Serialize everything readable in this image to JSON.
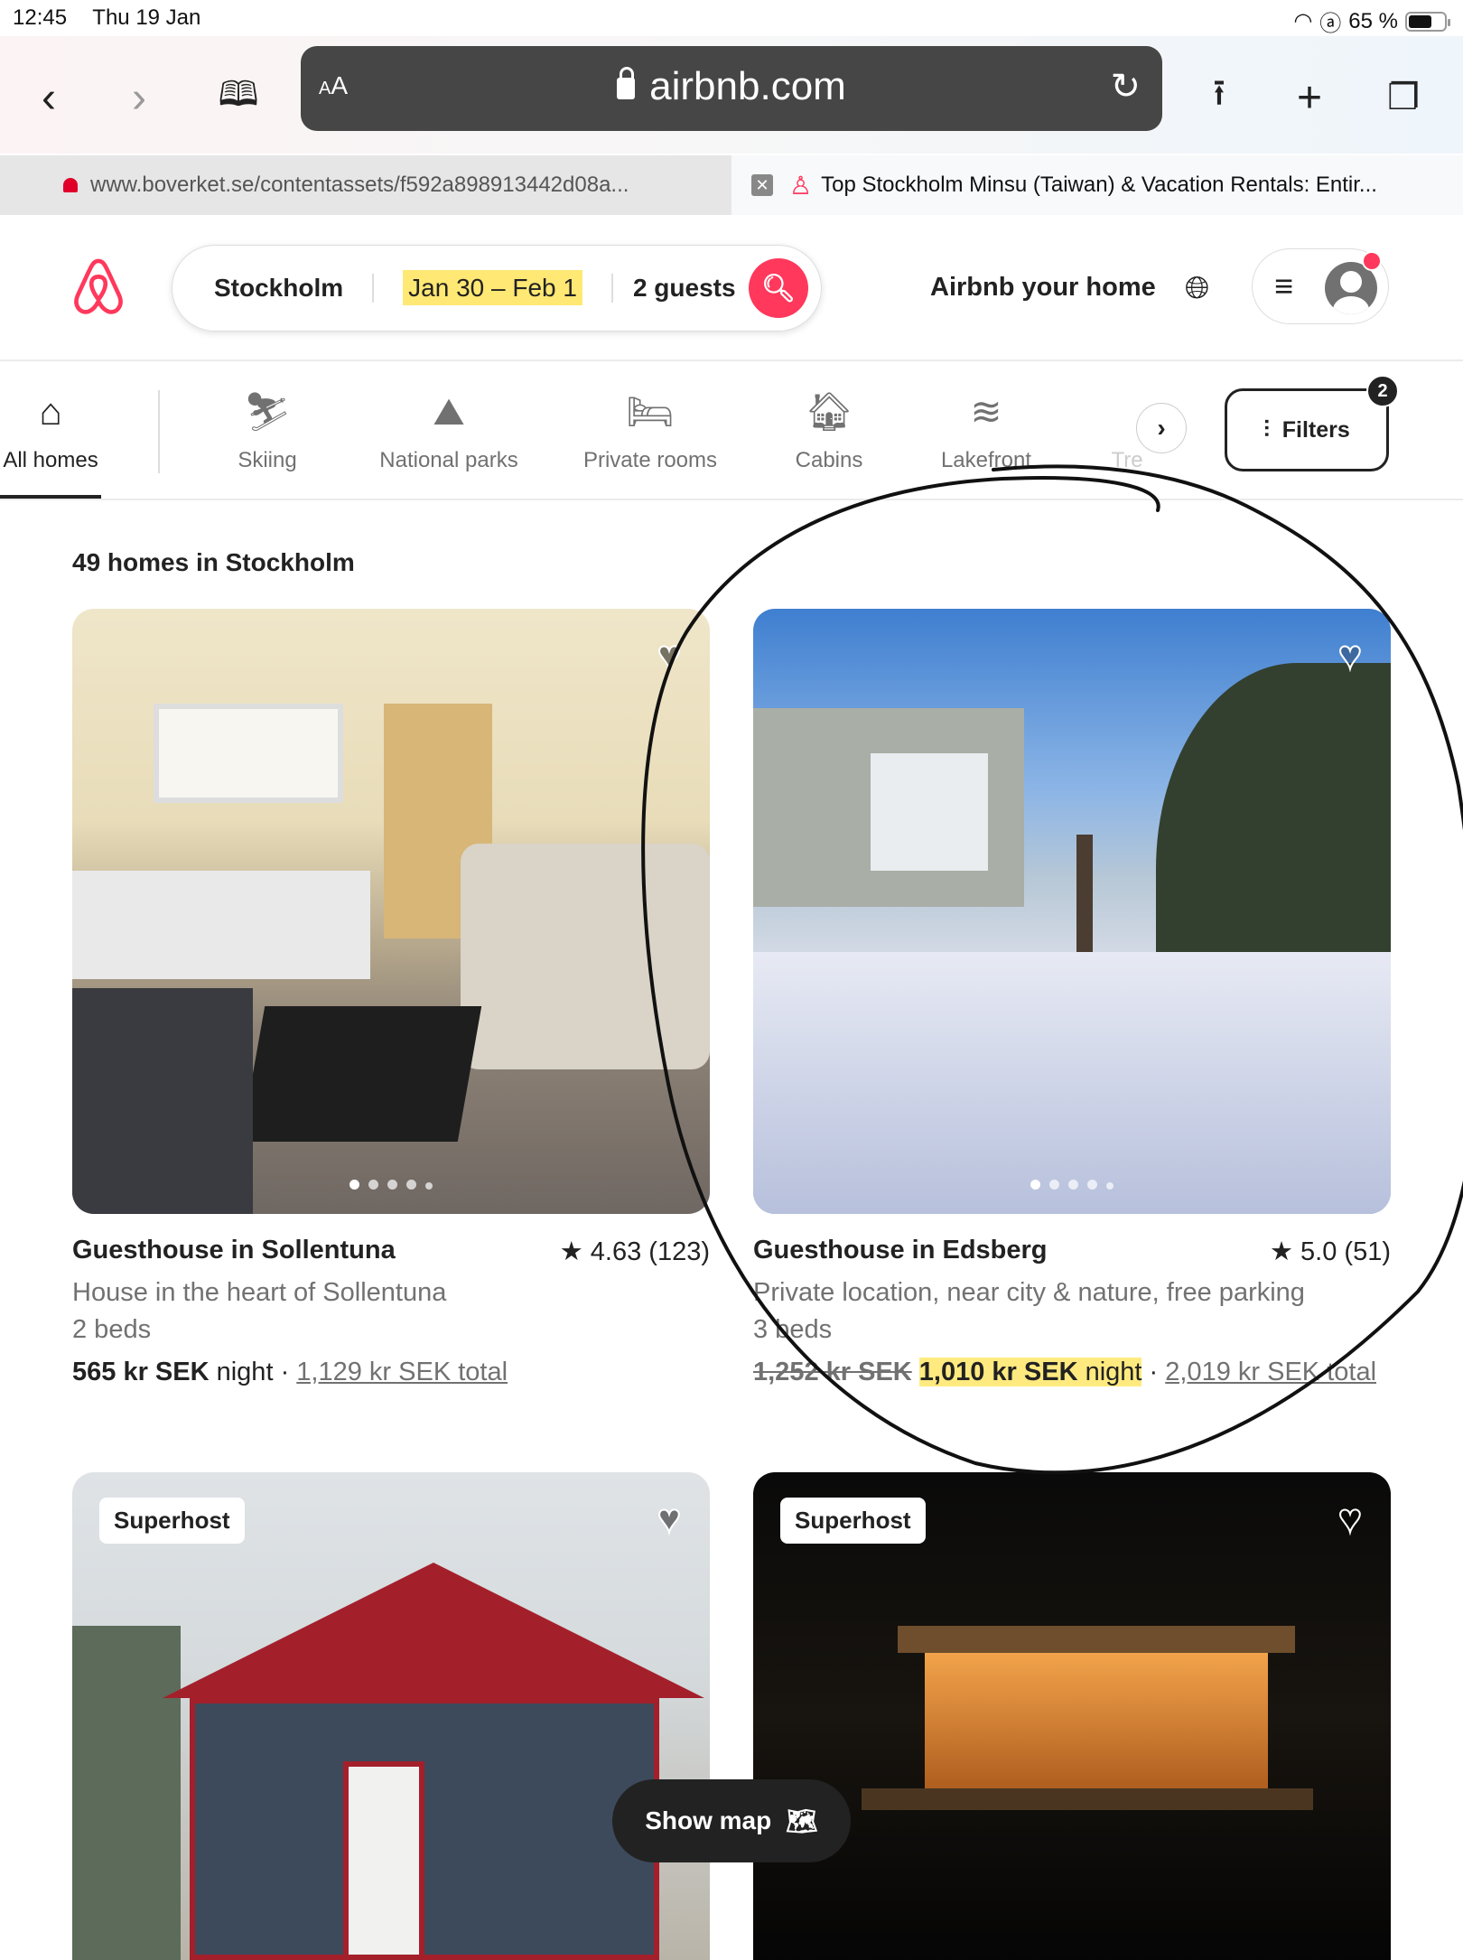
{
  "status_bar": {
    "time": "12:45",
    "date": "Thu 19 Jan",
    "battery": "65 %",
    "battery_level_pct": 65
  },
  "browser": {
    "url": "airbnb.com",
    "text_size_label": "AA",
    "tabs": [
      {
        "title": "www.boverket.se/contentassets/f592a898913442d08a...",
        "active": false
      },
      {
        "title": "Top Stockholm Minsu (Taiwan) & Vacation Rentals: Entir...",
        "active": true
      }
    ]
  },
  "header": {
    "search": {
      "location": "Stockholm",
      "dates": "Jan 30 – Feb 1",
      "guests": "2 guests"
    },
    "host_link": "Airbnb your home"
  },
  "categories": {
    "items": [
      {
        "label": "All homes",
        "icon": "house-icon",
        "active": true
      },
      {
        "label": "Skiing",
        "icon": "skiing-icon"
      },
      {
        "label": "National parks",
        "icon": "national-park-icon"
      },
      {
        "label": "Private rooms",
        "icon": "private-room-icon"
      },
      {
        "label": "Cabins",
        "icon": "cabin-icon"
      },
      {
        "label": "Lakefront",
        "icon": "lakefront-icon"
      },
      {
        "label": "Tre",
        "icon": "treehouse-icon"
      }
    ],
    "filters_label": "Filters",
    "filters_count": "2"
  },
  "results": {
    "count_label": "49 homes in Stockholm",
    "listings": [
      {
        "title": "Guesthouse in Sollentuna",
        "rating": "4.63 (123)",
        "subtitle": "House in the heart of Sollentuna",
        "beds": "2 beds",
        "price": "565 kr SEK",
        "night": "night",
        "separator": "·",
        "total": "1,129 kr SEK total",
        "photo_index": 1,
        "photo_count": 5
      },
      {
        "title": "Guesthouse in Edsberg",
        "rating": "5.0 (51)",
        "subtitle": "Private location, near city & nature, free parking",
        "beds": "3 beds",
        "original_price": "1,252 kr SEK",
        "price": "1,010 kr SEK",
        "night": "night",
        "separator": "·",
        "total": "2,019 kr SEK total",
        "photo_index": 1,
        "photo_count": 5
      },
      {
        "badge": "Superhost"
      },
      {
        "badge": "Superhost"
      }
    ]
  },
  "show_map_label": "Show map"
}
